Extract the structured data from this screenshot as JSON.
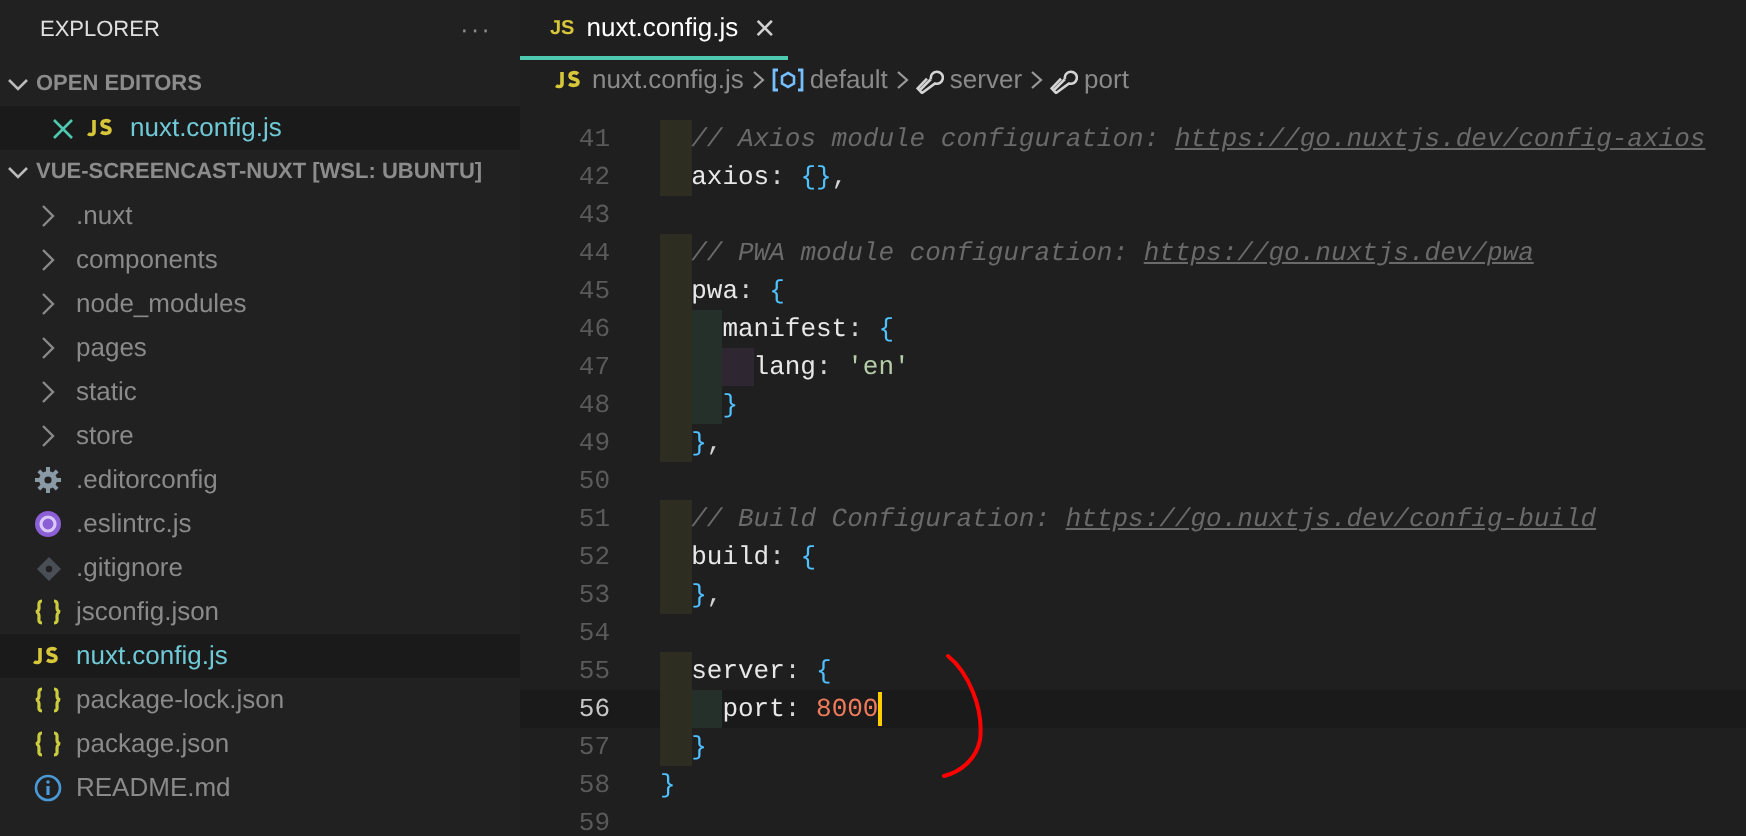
{
  "sidebar": {
    "title": "EXPLORER",
    "more": "···",
    "sections": [
      {
        "label": "OPEN EDITORS",
        "expanded": true,
        "items": [
          {
            "label": "nuxt.config.js",
            "kind": "js",
            "selected": true
          }
        ]
      },
      {
        "label": "VUE-SCREENCAST-NUXT [WSL: UBUNTU]",
        "expanded": true,
        "items": [
          {
            "label": ".nuxt",
            "kind": "folder",
            "selected": false
          },
          {
            "label": "components",
            "kind": "folder",
            "selected": false
          },
          {
            "label": "node_modules",
            "kind": "folder",
            "selected": false
          },
          {
            "label": "pages",
            "kind": "folder",
            "selected": false
          },
          {
            "label": "static",
            "kind": "folder",
            "selected": false
          },
          {
            "label": "store",
            "kind": "folder",
            "selected": false
          },
          {
            "label": ".editorconfig",
            "kind": "config",
            "selected": false
          },
          {
            "label": ".eslintrc.js",
            "kind": "eslint",
            "selected": false
          },
          {
            "label": ".gitignore",
            "kind": "git",
            "selected": false
          },
          {
            "label": "jsconfig.json",
            "kind": "json",
            "selected": false
          },
          {
            "label": "nuxt.config.js",
            "kind": "js",
            "selected": true
          },
          {
            "label": "package-lock.json",
            "kind": "json",
            "selected": false
          },
          {
            "label": "package.json",
            "kind": "json",
            "selected": false
          },
          {
            "label": "README.md",
            "kind": "info",
            "selected": false
          }
        ]
      }
    ]
  },
  "tab": {
    "badge": "JS",
    "label": "nuxt.config.js",
    "close": "×"
  },
  "breadcrumbs": [
    {
      "label": "nuxt.config.js",
      "kind": "js"
    },
    {
      "label": "default",
      "kind": "module"
    },
    {
      "label": "server",
      "kind": "wrench"
    },
    {
      "label": "port",
      "kind": "wrench"
    }
  ],
  "code": [
    {
      "number": "41",
      "current": false,
      "tokens": [
        {
          "kind": "comment",
          "text": "  // Axios module configuration: "
        },
        {
          "kind": "link",
          "text": "https://go.nuxtjs.dev/config-axios"
        }
      ]
    },
    {
      "number": "42",
      "current": false,
      "tokens": [
        {
          "kind": "key",
          "text": "  axios"
        },
        {
          "kind": "punct",
          "text": ": "
        },
        {
          "kind": "brace",
          "text": "{}"
        },
        {
          "kind": "punct",
          "text": ","
        }
      ]
    },
    {
      "number": "43",
      "current": false
    },
    {
      "number": "44",
      "current": false,
      "tokens": [
        {
          "kind": "comment",
          "text": "  // PWA module configuration: "
        },
        {
          "kind": "link",
          "text": "https://go.nuxtjs.dev/pwa"
        }
      ]
    },
    {
      "number": "45",
      "current": false,
      "tokens": [
        {
          "kind": "key",
          "text": "  pwa"
        },
        {
          "kind": "punct",
          "text": ": "
        },
        {
          "kind": "brace",
          "text": "{"
        }
      ]
    },
    {
      "number": "46",
      "current": false,
      "tokens": [
        {
          "kind": "key",
          "text": "    manifest"
        },
        {
          "kind": "punct",
          "text": ": "
        },
        {
          "kind": "brace",
          "text": "{"
        }
      ]
    },
    {
      "number": "47",
      "current": false,
      "tokens": [
        {
          "kind": "key",
          "text": "      lang"
        },
        {
          "kind": "punct",
          "text": ": "
        },
        {
          "kind": "string",
          "text": "'en'"
        }
      ]
    },
    {
      "number": "48",
      "current": false,
      "tokens": [
        {
          "kind": "brace",
          "text": "    }"
        }
      ]
    },
    {
      "number": "49",
      "current": false,
      "tokens": [
        {
          "kind": "brace",
          "text": "  }"
        },
        {
          "kind": "punct",
          "text": ","
        }
      ]
    },
    {
      "number": "50",
      "current": false
    },
    {
      "number": "51",
      "current": false,
      "tokens": [
        {
          "kind": "comment",
          "text": "  // Build Configuration: "
        },
        {
          "kind": "link",
          "text": "https://go.nuxtjs.dev/config-build"
        }
      ]
    },
    {
      "number": "52",
      "current": false,
      "tokens": [
        {
          "kind": "key",
          "text": "  build"
        },
        {
          "kind": "punct",
          "text": ": "
        },
        {
          "kind": "brace",
          "text": "{"
        }
      ]
    },
    {
      "number": "53",
      "current": false,
      "tokens": [
        {
          "kind": "brace",
          "text": "  }"
        },
        {
          "kind": "punct",
          "text": ","
        }
      ]
    },
    {
      "number": "54",
      "current": false
    },
    {
      "number": "55",
      "current": false,
      "tokens": [
        {
          "kind": "key",
          "text": "  server"
        },
        {
          "kind": "punct",
          "text": ": "
        },
        {
          "kind": "brace",
          "text": "{"
        }
      ]
    },
    {
      "number": "56",
      "current": true,
      "tokens": [
        {
          "kind": "key",
          "text": "    port"
        },
        {
          "kind": "punct",
          "text": ": "
        },
        {
          "kind": "number",
          "text": "8000"
        }
      ]
    },
    {
      "number": "57",
      "current": false,
      "tokens": [
        {
          "kind": "brace",
          "text": "  }"
        }
      ]
    },
    {
      "number": "58",
      "current": false,
      "tokens": [
        {
          "kind": "brace",
          "text": "}"
        }
      ]
    },
    {
      "number": "59",
      "current": false
    }
  ]
}
